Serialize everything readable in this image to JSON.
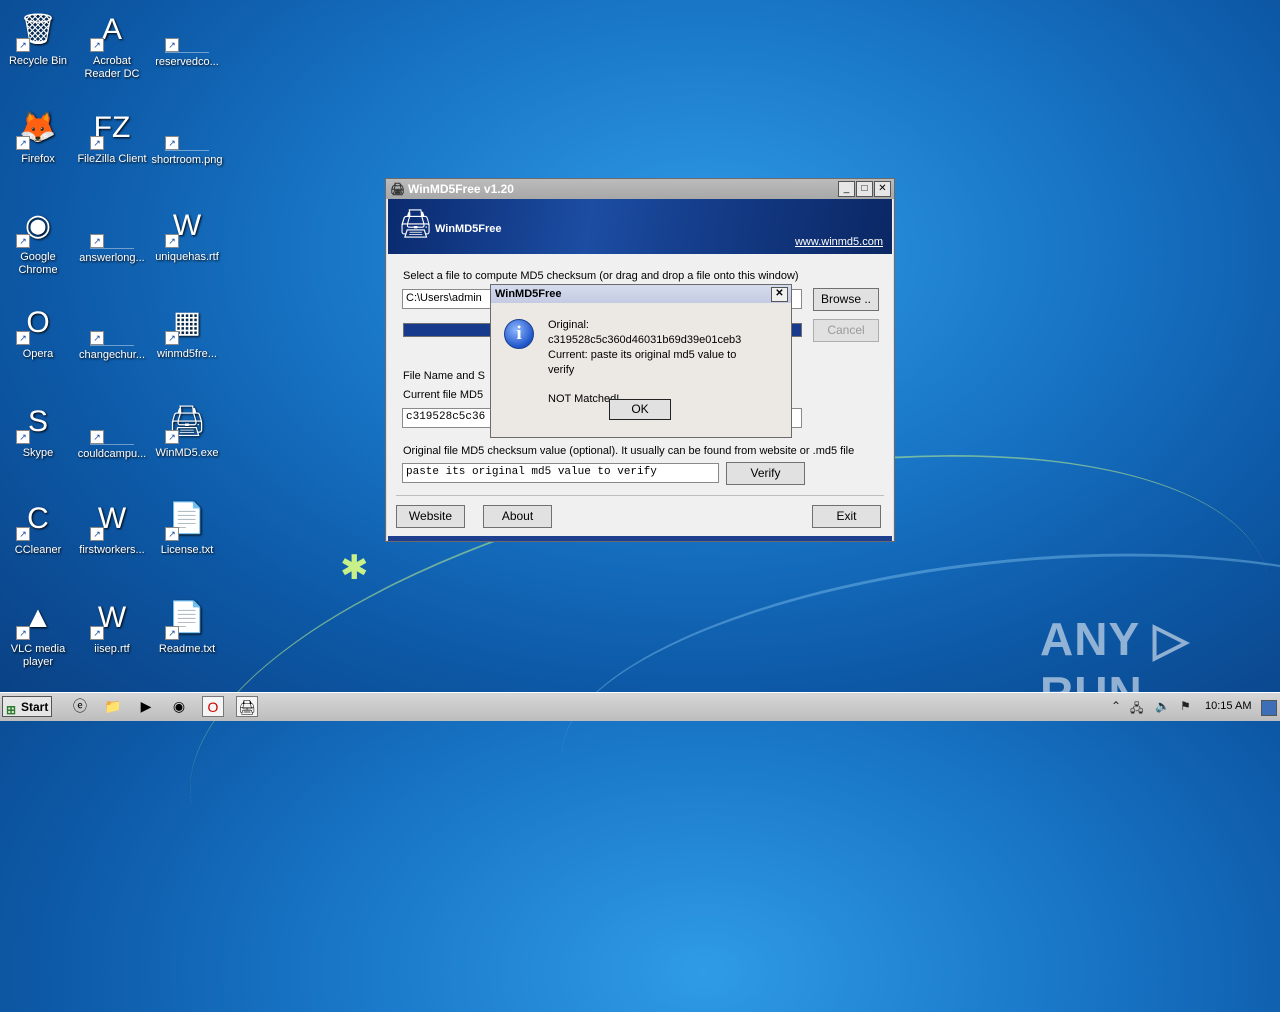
{
  "desktop": {
    "icons": [
      {
        "label": "Recycle Bin",
        "glyph": "🗑"
      },
      {
        "label": "Acrobat Reader DC",
        "glyph": "A"
      },
      {
        "label": "reservedco...",
        "glyph": ""
      },
      {
        "label": "Firefox",
        "glyph": "🦊"
      },
      {
        "label": "FileZilla Client",
        "glyph": "FZ"
      },
      {
        "label": "shortroom.png",
        "glyph": ""
      },
      {
        "label": "Google Chrome",
        "glyph": "◉"
      },
      {
        "label": "answerlong...",
        "glyph": ""
      },
      {
        "label": "uniquehas.rtf",
        "glyph": "W"
      },
      {
        "label": "Opera",
        "glyph": "O"
      },
      {
        "label": "changechur...",
        "glyph": ""
      },
      {
        "label": "winmd5fre...",
        "glyph": "▦"
      },
      {
        "label": "Skype",
        "glyph": "S"
      },
      {
        "label": "couldcampu...",
        "glyph": ""
      },
      {
        "label": "WinMD5.exe",
        "glyph": "🖨"
      },
      {
        "label": "CCleaner",
        "glyph": "C"
      },
      {
        "label": "firstworkers...",
        "glyph": "W"
      },
      {
        "label": "License.txt",
        "glyph": "📄"
      },
      {
        "label": "VLC media player",
        "glyph": "▲"
      },
      {
        "label": "iisep.rtf",
        "glyph": "W"
      },
      {
        "label": "Readme.txt",
        "glyph": "📄"
      }
    ]
  },
  "window": {
    "title": "WinMD5Free v1.20",
    "banner_name": "WinMD5Free",
    "banner_url": "www.winmd5.com",
    "select_label": "Select a file to compute MD5 checksum (or drag and drop a file onto this window)",
    "path_value": "C:\\Users\\admin",
    "browse_label": "Browse ..",
    "cancel_label": "Cancel",
    "progress": 1.0,
    "file_name_label": "File Name and S",
    "current_md5_label": "Current file MD5",
    "current_md5_value": "c319528c5c36",
    "original_label": "Original file MD5 checksum value (optional). It usually can be found from website or .md5 file",
    "original_value": "paste its original md5 value to verify",
    "verify_label": "Verify",
    "website_label": "Website",
    "about_label": "About",
    "exit_label": "Exit"
  },
  "dialog": {
    "title": "WinMD5Free",
    "close": "✕",
    "line1": "Original:",
    "line2": "c319528c5c360d46031b69d39e01ceb3",
    "line3": "Current: paste its original md5 value to",
    "line4": "verify",
    "line5": "NOT Matched!",
    "ok_label": "OK"
  },
  "watermark": "ANY ▷ RUN",
  "taskbar": {
    "start_label": "Start",
    "clock": "10:15 AM"
  }
}
